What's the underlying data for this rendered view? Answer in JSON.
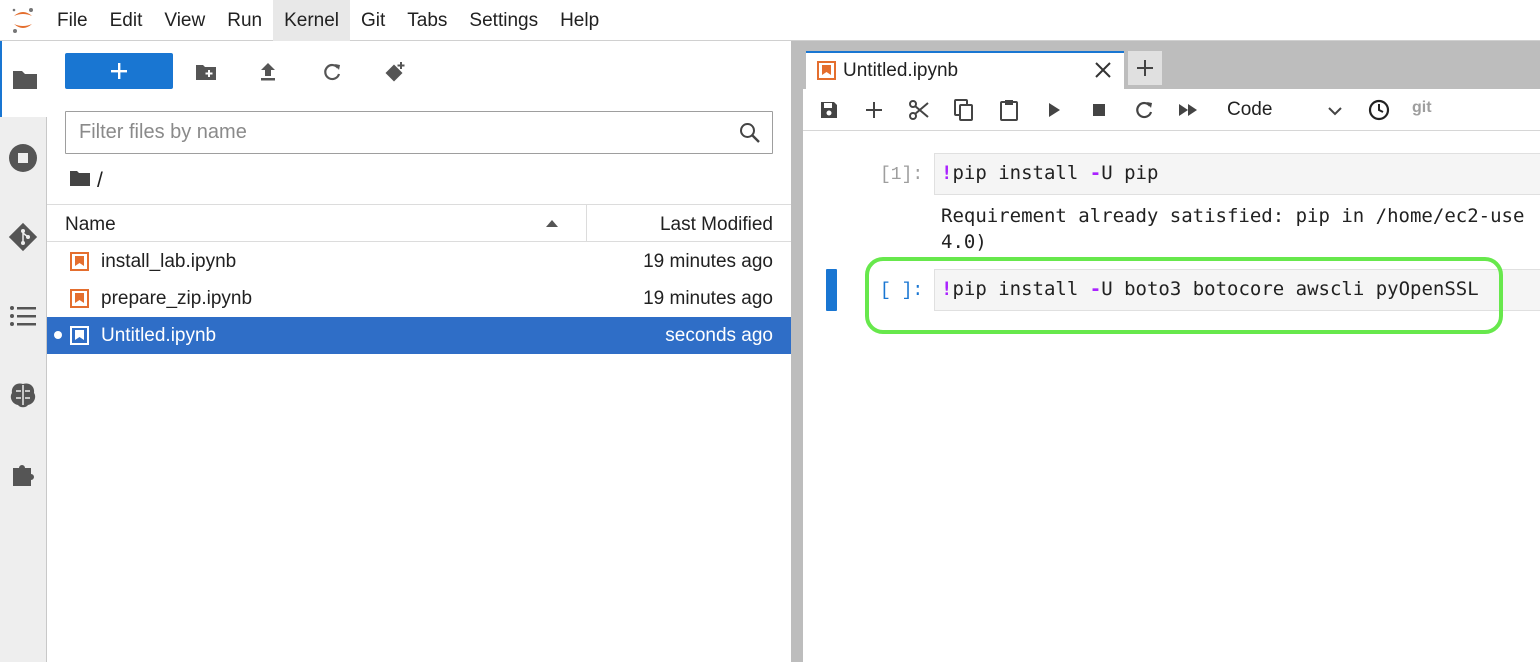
{
  "menu": {
    "items": [
      "File",
      "Edit",
      "View",
      "Run",
      "Kernel",
      "Git",
      "Tabs",
      "Settings",
      "Help"
    ],
    "active": "Kernel"
  },
  "activity_bar": {
    "icons": [
      "folder-icon",
      "running-stop-icon",
      "git-icon",
      "table-of-contents-icon",
      "extension-brain-icon",
      "puzzle-extension-icon"
    ],
    "active": "folder-icon"
  },
  "filebrowser": {
    "new_label": "+",
    "filter_placeholder": "Filter files by name",
    "breadcrumb": "/",
    "headers": {
      "name": "Name",
      "modified": "Last Modified"
    },
    "files": [
      {
        "name": "install_lab.ipynb",
        "modified": "19 minutes ago",
        "selected": false,
        "running": false
      },
      {
        "name": "prepare_zip.ipynb",
        "modified": "19 minutes ago",
        "selected": false,
        "running": false
      },
      {
        "name": "Untitled.ipynb",
        "modified": "seconds ago",
        "selected": true,
        "running": true
      }
    ]
  },
  "notebook": {
    "tab_title": "Untitled.ipynb",
    "add_tab": "+",
    "cell_type": "Code",
    "git_label": "git",
    "cells": [
      {
        "prompt": "[1]:",
        "bang": "!",
        "code_a": "pip install ",
        "op": "-",
        "code_b": "U pip",
        "output_line1": "Requirement already satisfied: pip in /home/ec2-use",
        "output_line2": "4.0)"
      },
      {
        "prompt": "[ ]:",
        "bang": "!",
        "code_a": "pip install ",
        "op": "-",
        "code_b": "U boto3 botocore awscli pyOpenSSL"
      }
    ]
  },
  "colors": {
    "accent": "#1976d2",
    "selection": "#2f6ec7",
    "highlight": "#67e84c",
    "notebook_orange": "#e46e2e"
  }
}
